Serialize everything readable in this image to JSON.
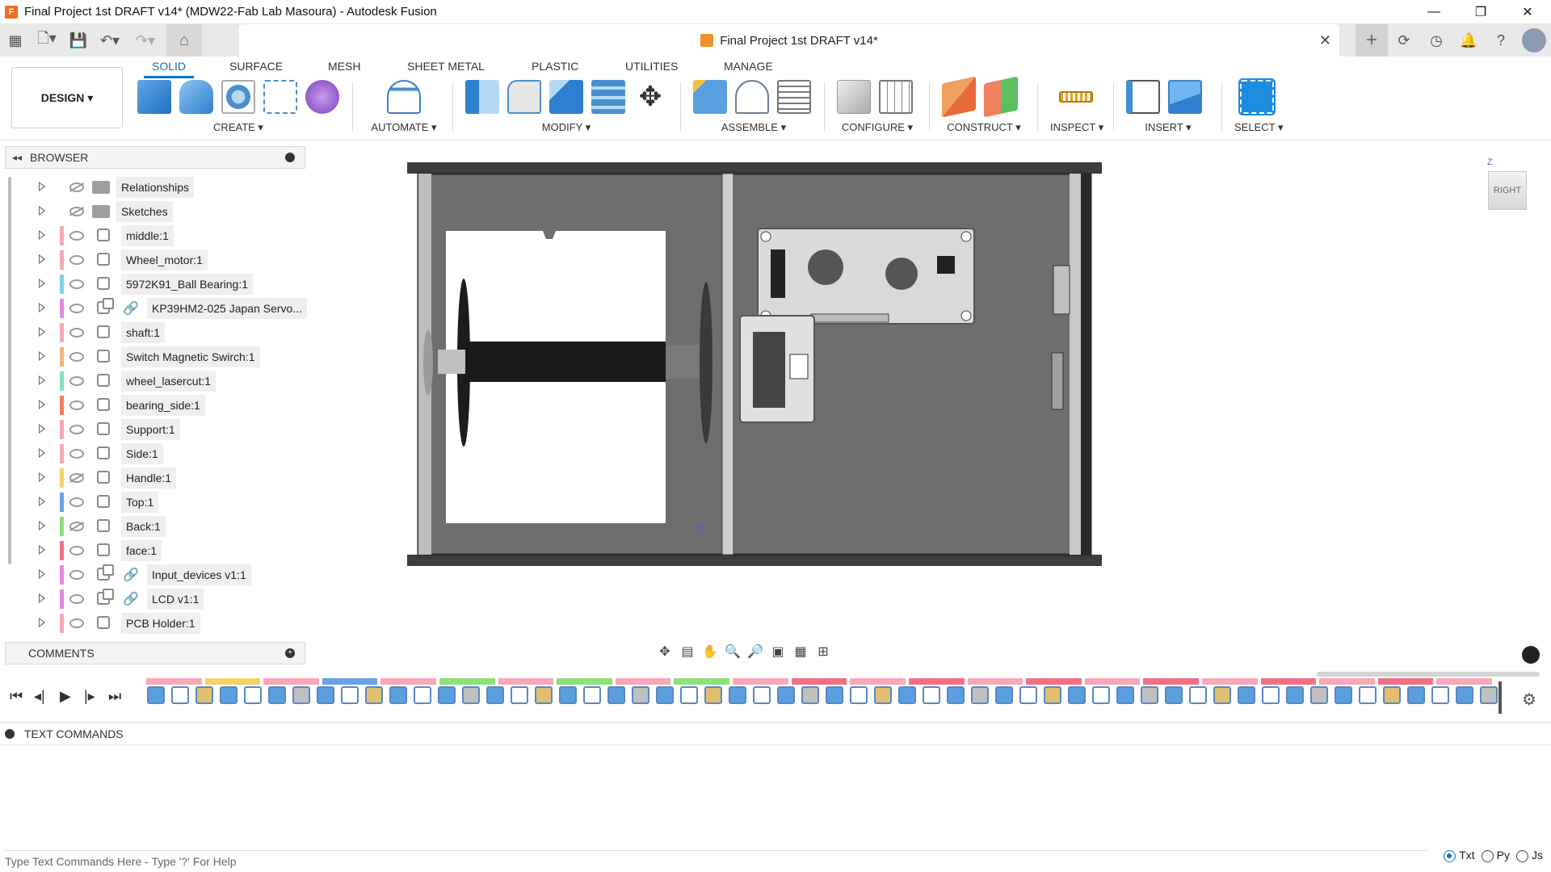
{
  "window": {
    "title": "Final Project 1st DRAFT v14* (MDW22-Fab Lab Masoura) - Autodesk Fusion",
    "controls": [
      "—",
      "❐",
      "✕"
    ]
  },
  "document_tab": {
    "title": "Final Project 1st DRAFT v14*",
    "close": "✕"
  },
  "workspace": {
    "label": "DESIGN ▾"
  },
  "tabs": [
    "SOLID",
    "SURFACE",
    "MESH",
    "SHEET METAL",
    "PLASTIC",
    "UTILITIES",
    "MANAGE"
  ],
  "groups": {
    "create": "CREATE ▾",
    "automate": "AUTOMATE ▾",
    "modify": "MODIFY ▾",
    "assemble": "ASSEMBLE ▾",
    "configure": "CONFIGURE ▾",
    "construct": "CONSTRUCT ▾",
    "inspect": "INSPECT ▾",
    "insert": "INSERT ▾",
    "select": "SELECT ▾"
  },
  "browser": {
    "title": "BROWSER",
    "items": [
      {
        "label": "Relationships",
        "type": "folder",
        "visible": false,
        "color": ""
      },
      {
        "label": "Sketches",
        "type": "folder",
        "visible": false,
        "color": ""
      },
      {
        "label": "middle:1",
        "type": "component",
        "visible": true,
        "color": "#f6a9b8"
      },
      {
        "label": "Wheel_motor:1",
        "type": "component",
        "visible": true,
        "color": "#f6a9b8"
      },
      {
        "label": "5972K91_Ball Bearing:1",
        "type": "component",
        "visible": true,
        "color": "#7fd4e0"
      },
      {
        "label": "KP39HM2-025 Japan Servo...",
        "type": "linked",
        "visible": true,
        "color": "#e28ae0"
      },
      {
        "label": "shaft:1",
        "type": "component",
        "visible": true,
        "color": "#f6a9b8"
      },
      {
        "label": "Switch Magnetic Swirch:1",
        "type": "component",
        "visible": true,
        "color": "#f3b57c"
      },
      {
        "label": "wheel_lasercut:1",
        "type": "component",
        "visible": true,
        "color": "#84e0c8"
      },
      {
        "label": "bearing_side:1",
        "type": "component",
        "visible": true,
        "color": "#f08060"
      },
      {
        "label": "Support:1",
        "type": "component",
        "visible": true,
        "color": "#f6a9b8"
      },
      {
        "label": "Side:1",
        "type": "component",
        "visible": true,
        "color": "#f6a9b8"
      },
      {
        "label": "Handle:1",
        "type": "component",
        "visible": false,
        "color": "#f2d36a"
      },
      {
        "label": "Top:1",
        "type": "component",
        "visible": true,
        "color": "#6aa2e8"
      },
      {
        "label": "Back:1",
        "type": "component",
        "visible": false,
        "color": "#8ee07a"
      },
      {
        "label": "face:1",
        "type": "component",
        "visible": true,
        "color": "#f07088"
      },
      {
        "label": "Input_devices v1:1",
        "type": "linked",
        "visible": true,
        "color": "#e28ae0"
      },
      {
        "label": "LCD v1:1",
        "type": "linked",
        "visible": true,
        "color": "#e28ae0"
      },
      {
        "label": "PCB Holder:1",
        "type": "component",
        "visible": true,
        "color": "#f6a9b8"
      }
    ]
  },
  "comments": {
    "title": "COMMENTS"
  },
  "viewcube": {
    "face": "RIGHT",
    "axis": "Z"
  },
  "text_commands": {
    "title": "TEXT COMMANDS",
    "placeholder": "Type Text Commands Here - Type '?' For Help",
    "modes": [
      "Txt",
      "Py",
      "Js"
    ],
    "selected_mode": "Txt"
  },
  "colors": {
    "accent": "#0a72c9",
    "app_logo": "#f26d21"
  }
}
